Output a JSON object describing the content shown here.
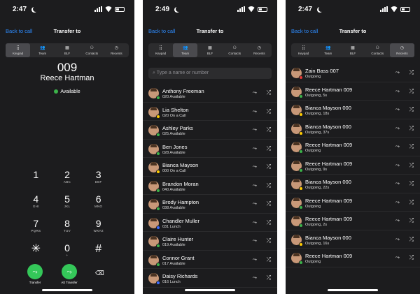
{
  "colors": {
    "accent": "#2d8cff",
    "available": "#3cb34a",
    "busy": "#ffcc00",
    "call_green": "#34c759"
  },
  "tabs": [
    {
      "label": "Keypad",
      "icon": "keypad-icon"
    },
    {
      "label": "Team",
      "icon": "team-icon"
    },
    {
      "label": "BLF",
      "icon": "blf-icon"
    },
    {
      "label": "Contacts",
      "icon": "contacts-icon"
    },
    {
      "label": "Recents",
      "icon": "recents-icon"
    }
  ],
  "screen1": {
    "time": "2:47",
    "back": "Back to call",
    "title": "Transfer to",
    "dial_number": "009",
    "contact_name": "Reece Hartman",
    "status": "Available",
    "keys": [
      {
        "d": "1",
        "l": ""
      },
      {
        "d": "2",
        "l": "ABC"
      },
      {
        "d": "3",
        "l": "DEF"
      },
      {
        "d": "4",
        "l": "GHI"
      },
      {
        "d": "5",
        "l": "JKL"
      },
      {
        "d": "6",
        "l": "MNO"
      },
      {
        "d": "7",
        "l": "PQRS"
      },
      {
        "d": "8",
        "l": "TUV"
      },
      {
        "d": "9",
        "l": "WXYZ"
      },
      {
        "d": "✳",
        "l": ""
      },
      {
        "d": "0",
        "l": "+"
      },
      {
        "d": "#",
        "l": ""
      }
    ],
    "transfer_label": "Transfer",
    "att_transfer_label": "Att Transfer"
  },
  "screen2": {
    "time": "2:49",
    "back": "Back to call",
    "title": "Transfer to",
    "search_placeholder": "Type a name or number",
    "contacts": [
      {
        "name": "Anthony Freeman",
        "status": "020 Available",
        "dot": "#3cb34a"
      },
      {
        "name": "Lia Shelton",
        "status": "020 On a Call",
        "dot": "#ffcc00"
      },
      {
        "name": "Ashley Parks",
        "status": "025 Available",
        "dot": "#3cb34a"
      },
      {
        "name": "Ben Jones",
        "status": "028 Available",
        "dot": "#3cb34a"
      },
      {
        "name": "Bianca Mayson",
        "status": "000 On a Call",
        "dot": "#ffcc00"
      },
      {
        "name": "Brandon Moran",
        "status": "040 Available",
        "dot": "#3cb34a"
      },
      {
        "name": "Brody Hampton",
        "status": "038 Available",
        "dot": "#3cb34a"
      },
      {
        "name": "Chandler Muller",
        "status": "031 Lunch",
        "dot": "#3c6bff"
      },
      {
        "name": "Claire Hunter",
        "status": "019 Available",
        "dot": "#3cb34a"
      },
      {
        "name": "Connor Grant",
        "status": "017 Available",
        "dot": "#3cb34a"
      },
      {
        "name": "Daisy Richards",
        "status": "016 Lunch",
        "dot": "#3c6bff"
      }
    ]
  },
  "screen3": {
    "time": "2:47",
    "back": "Back to call",
    "title": "Transfer to",
    "recents": [
      {
        "name": "Zain Bass 007",
        "status": "Outgoing",
        "dot": "#e53935"
      },
      {
        "name": "Reece Hartman 009",
        "status": "Outgoing, 5s",
        "dot": "#3cb34a"
      },
      {
        "name": "Bianca Mayson 000",
        "status": "Outgoing, 18s",
        "dot": "#ffcc00"
      },
      {
        "name": "Bianca Mayson 000",
        "status": "Outgoing, 37s",
        "dot": "#ffcc00"
      },
      {
        "name": "Reece Hartman 009",
        "status": "Outgoing",
        "dot": "#3cb34a"
      },
      {
        "name": "Reece Hartman 009",
        "status": "Outgoing, 9s",
        "dot": "#3cb34a"
      },
      {
        "name": "Bianca Mayson 000",
        "status": "Outgoing, 22s",
        "dot": "#ffcc00"
      },
      {
        "name": "Reece Hartman 009",
        "status": "Outgoing",
        "dot": "#3cb34a"
      },
      {
        "name": "Reece Hartman 009",
        "status": "Outgoing, 2s",
        "dot": "#3cb34a"
      },
      {
        "name": "Bianca Mayson 000",
        "status": "Outgoing, 16s",
        "dot": "#ffcc00"
      },
      {
        "name": "Reece Hartman 009",
        "status": "Outgoing",
        "dot": "#3cb34a"
      }
    ]
  }
}
